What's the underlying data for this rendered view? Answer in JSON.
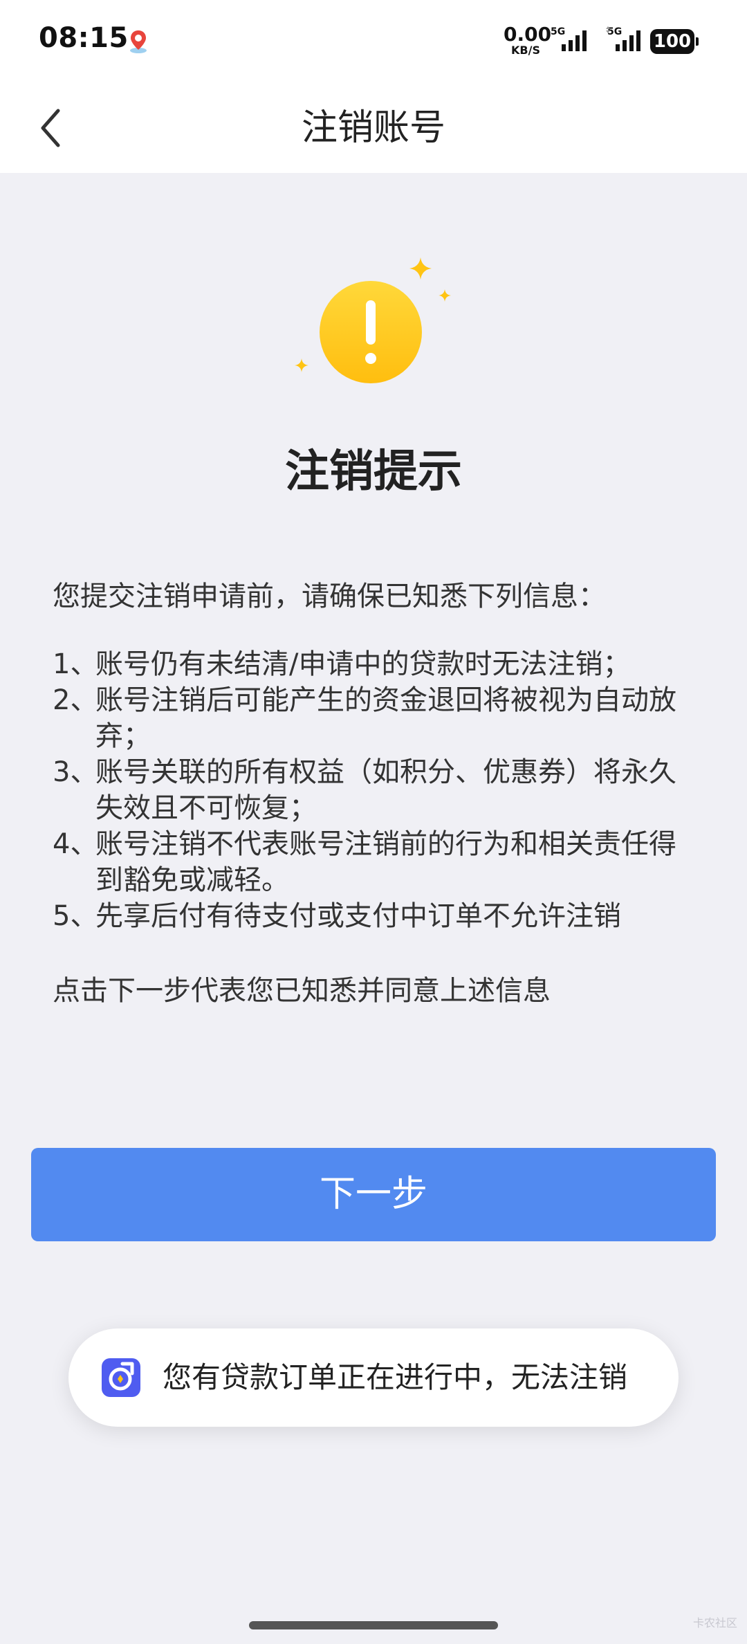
{
  "status_bar": {
    "time": "08:15",
    "net_speed_value": "0.00",
    "net_speed_unit": "KB/S",
    "signal1_tag": "5G",
    "signal2_tag": "5G",
    "battery": "100",
    "map_icon": "map-pin-icon"
  },
  "nav": {
    "title": "注销账号",
    "back_icon": "chevron-left-icon"
  },
  "hero": {
    "icon": "warning-exclamation-icon",
    "title": "注销提示",
    "accent_color": "#ffc414"
  },
  "notice": {
    "intro": "您提交注销申请前，请确保已知悉下列信息：",
    "items": [
      {
        "num": "1、",
        "text": "账号仍有未结清/申请中的贷款时无法注销；"
      },
      {
        "num": "2、",
        "text": "账号注销后可能产生的资金退回将被视为自动放弃；"
      },
      {
        "num": "3、",
        "text": "账号关联的所有权益（如积分、优惠券）将永久失效且不可恢复；"
      },
      {
        "num": "4、",
        "text": "账号注销不代表账号注销前的行为和相关责任得到豁免或减轻。"
      },
      {
        "num": "5、",
        "text": "先享后付有待支付或支付中订单不允许注销"
      }
    ],
    "agree": "点击下一步代表您已知悉并同意上述信息"
  },
  "next_button": {
    "label": "下一步",
    "color": "#528af0"
  },
  "toast": {
    "icon": "app-logo-icon",
    "message": "您有贷款订单正在进行中，无法注销"
  },
  "watermark": "卡农社区"
}
